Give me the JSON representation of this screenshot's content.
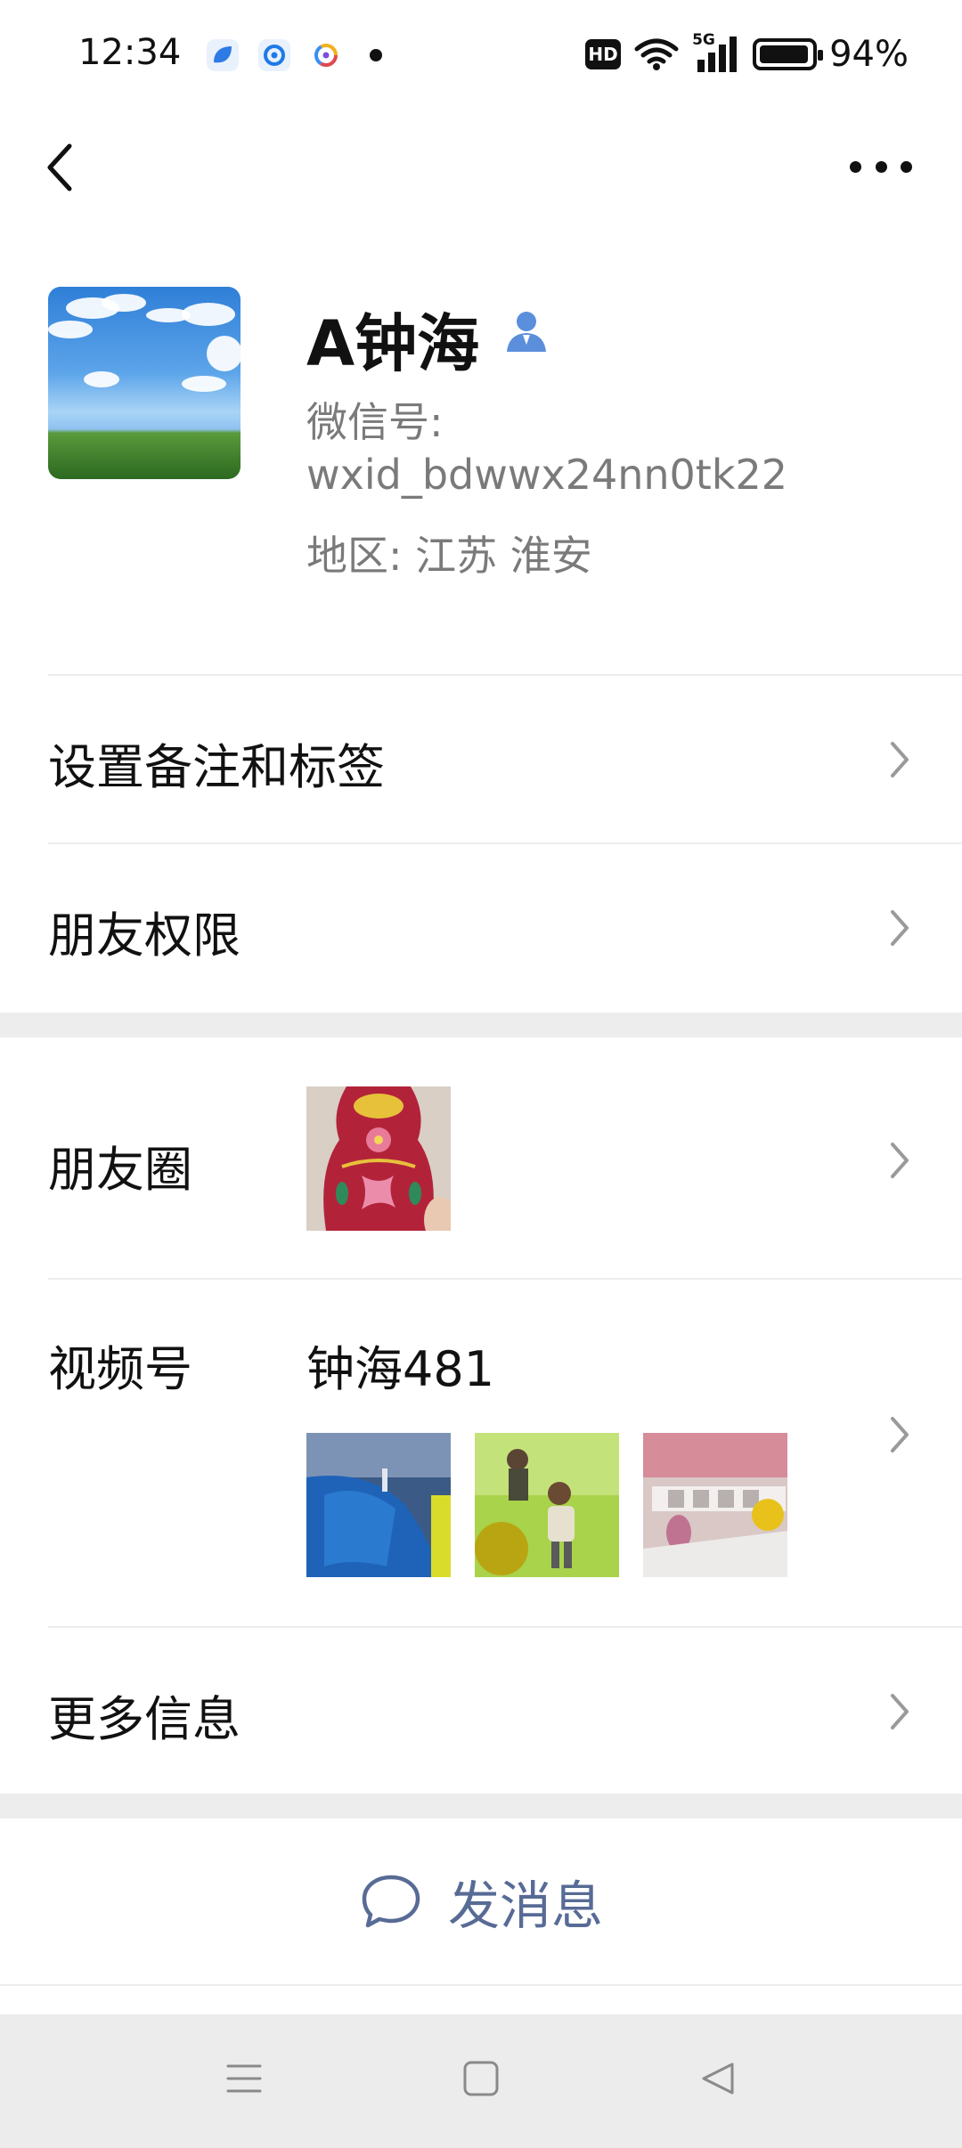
{
  "status_bar": {
    "time": "12:34",
    "hd_badge": "HD",
    "network": "5G",
    "battery_percent": "94%",
    "battery_level": 0.94,
    "app_icons": [
      "blue-leaf-app-icon",
      "blue-q-app-icon",
      "colorful-ring-app-icon"
    ]
  },
  "nav": {
    "back_icon": "chevron-left-icon",
    "more_icon": "more-dots-icon"
  },
  "profile": {
    "name": "A钟海",
    "contact_icon": "person-icon",
    "wechat_id_label": "微信号:",
    "wechat_id": "wxid_bdwwx24nn0tk22",
    "region": "地区:  江苏  淮安"
  },
  "settings": {
    "remark_tags": "设置备注和标签",
    "friend_permissions": "朋友权限"
  },
  "moments": {
    "label": "朋友圈"
  },
  "channels": {
    "label": "视频号",
    "name": "钟海481"
  },
  "more_info": {
    "label": "更多信息"
  },
  "actions": {
    "send_message": "发消息",
    "send_icon": "chat-bubble-icon"
  },
  "system_nav": {
    "menu_icon": "menu-icon",
    "home_icon": "home-square-icon",
    "back_icon": "triangle-back-icon"
  },
  "colors": {
    "link_blue": "#576b95",
    "separator": "#ededed",
    "secondary_text": "#7a7a7a"
  }
}
